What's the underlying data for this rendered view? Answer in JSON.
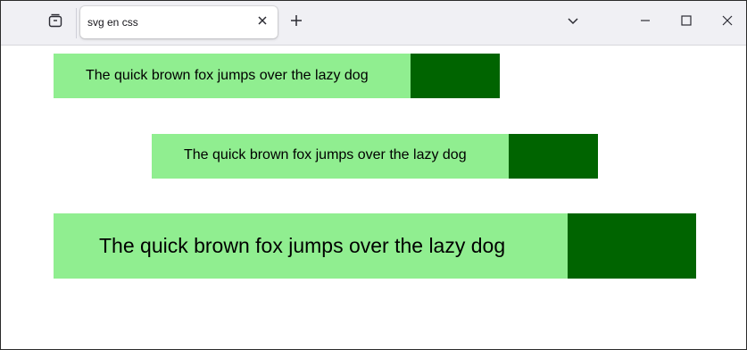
{
  "browser": {
    "tab": {
      "title": "svg en css",
      "close_icon": "close-icon"
    },
    "icons": {
      "tab_manager": "tab-manager-icon",
      "new_tab": "plus-icon",
      "list_all_tabs": "chevron-down-icon",
      "minimize": "minimize-icon",
      "maximize": "maximize-icon",
      "close": "close-icon"
    }
  },
  "content": {
    "bars": [
      {
        "text": "The quick brown fox jumps over the lazy dog"
      },
      {
        "text": "The quick brown fox jumps over the lazy dog"
      },
      {
        "text": "The quick brown fox jumps over the lazy dog"
      }
    ]
  },
  "colors": {
    "light_green": "#90ee90",
    "dark_green": "#006400",
    "titlebar": "#f0f0f4"
  }
}
